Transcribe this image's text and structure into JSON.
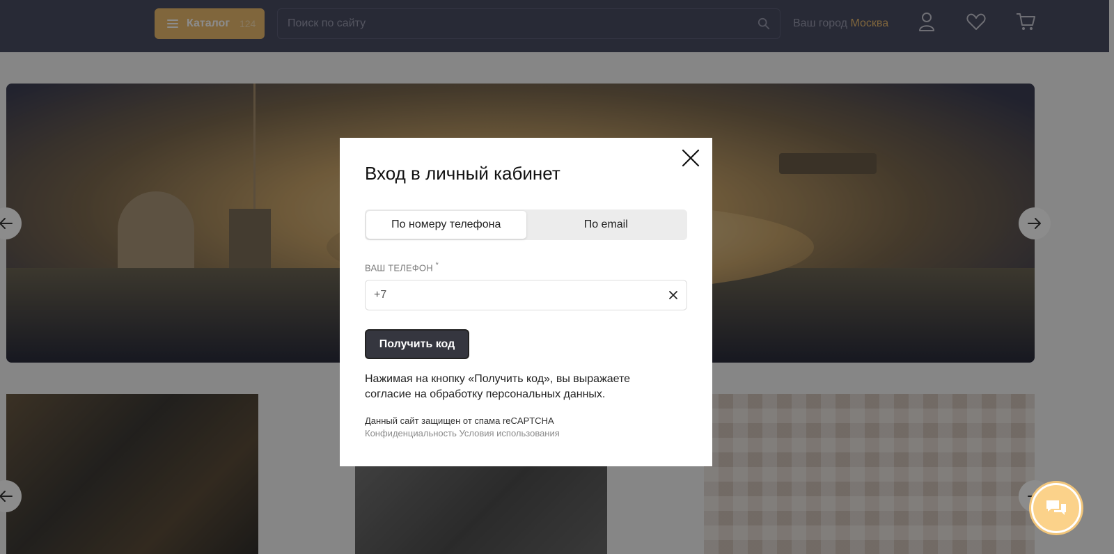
{
  "header": {
    "catalog_label": "Каталог",
    "catalog_count": "124",
    "search_placeholder": "Поиск по сайту",
    "city_prefix": "Ваш город",
    "city_name": "Москва"
  },
  "modal": {
    "title": "Вход в личный кабинет",
    "tabs": [
      {
        "label": "По номеру телефона",
        "active": true
      },
      {
        "label": "По email",
        "active": false
      }
    ],
    "phone_label": "ВАШ ТЕЛЕФОН",
    "phone_required_mark": "*",
    "phone_value": "+7",
    "submit_label": "Получить код",
    "consent_text": "Нажимая на кнопку «Получить код», вы выражаете согласие на обработку персональных данных.",
    "captcha_text": "Данный сайт защищен от спама reCAPTCHA",
    "privacy_link": "Конфиденциальность",
    "terms_link": "Условия использования"
  },
  "colors": {
    "header_bg": "#4a4d63",
    "accent": "#e9ba6e",
    "button_dark": "#35363f"
  }
}
